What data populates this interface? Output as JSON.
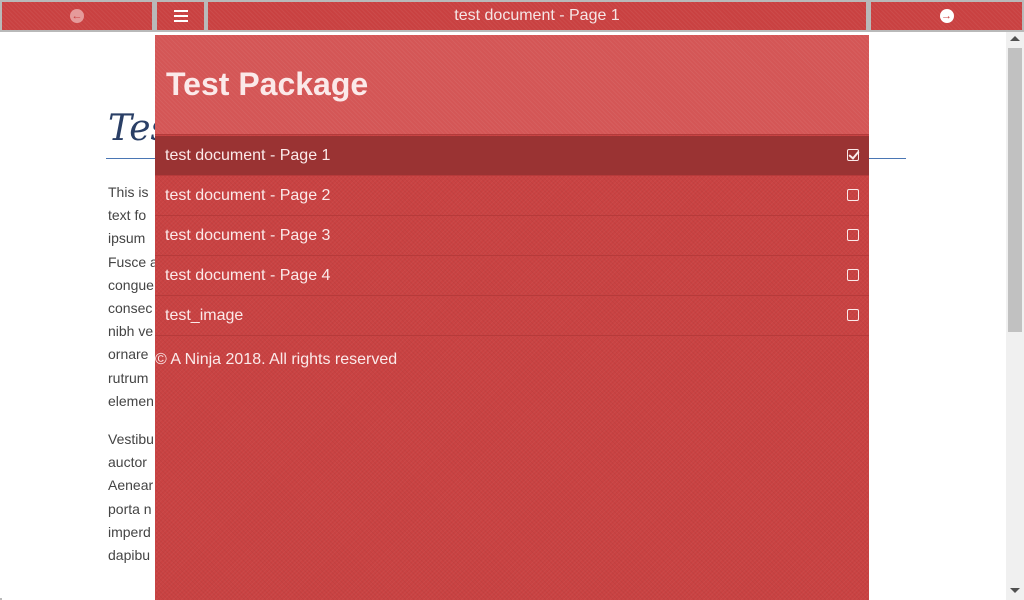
{
  "topbar": {
    "prev_icon": "circle-arrow-left-icon",
    "menu_icon": "hamburger-menu-icon",
    "title": "test document - Page 1",
    "next_icon": "circle-arrow-right-icon"
  },
  "document": {
    "title_fragment": "Tes",
    "paragraph1": [
      "This is",
      "text fo",
      "ipsum",
      "Fusce a",
      "congue",
      "consec",
      "nibh ve",
      "ornare",
      "rutrum",
      "elemen"
    ],
    "paragraph2": [
      "Vestibu",
      "auctor",
      "Aenear",
      "porta n",
      "imperd",
      "dapibu"
    ]
  },
  "menu": {
    "title": "Test Package",
    "items": [
      {
        "label": "test document - Page 1",
        "checked": true
      },
      {
        "label": "test document - Page 2",
        "checked": false
      },
      {
        "label": "test document - Page 3",
        "checked": false
      },
      {
        "label": "test document - Page 4",
        "checked": false
      },
      {
        "label": "test_image",
        "checked": false
      }
    ],
    "footer": "© A Ninja 2018. All rights reserved"
  },
  "colors": {
    "accent": "#c94141",
    "active_item": "#9a3333",
    "header": "#d45656"
  }
}
